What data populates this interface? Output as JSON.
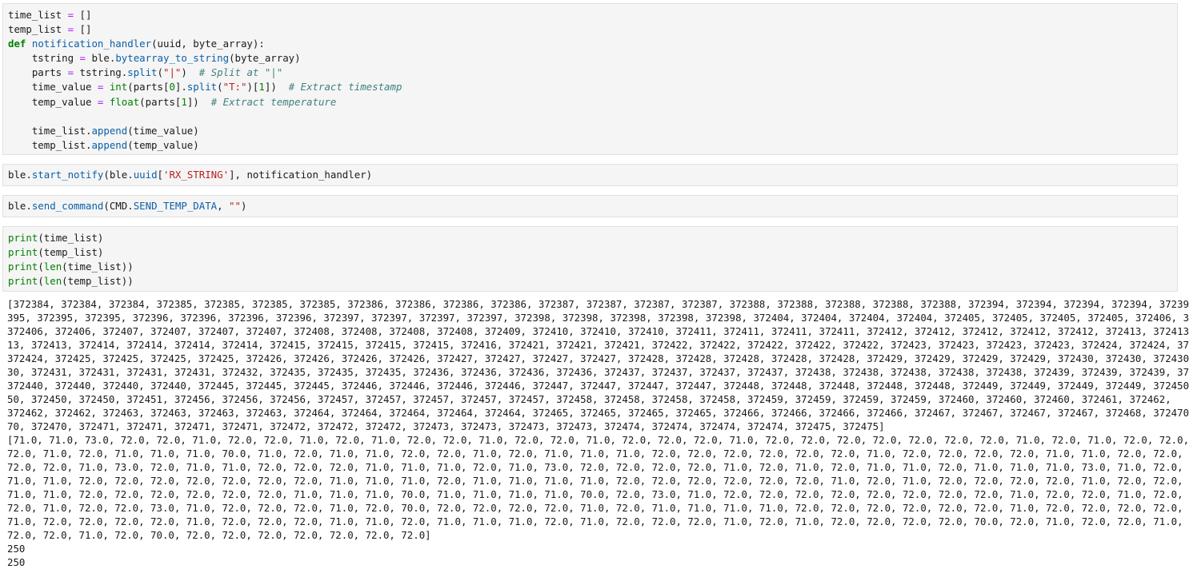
{
  "cells": [
    {
      "lines": [
        [
          {
            "t": "time_list ",
            "c": ""
          },
          {
            "t": "=",
            "c": "op"
          },
          {
            "t": " []",
            "c": ""
          }
        ],
        [
          {
            "t": "temp_list ",
            "c": ""
          },
          {
            "t": "=",
            "c": "op"
          },
          {
            "t": " []",
            "c": ""
          }
        ],
        [
          {
            "t": "def",
            "c": "kw"
          },
          {
            "t": " ",
            "c": ""
          },
          {
            "t": "notification_handler",
            "c": "fn"
          },
          {
            "t": "(uuid, byte_array):",
            "c": ""
          }
        ],
        [
          {
            "t": "    tstring ",
            "c": ""
          },
          {
            "t": "=",
            "c": "op"
          },
          {
            "t": " ble.",
            "c": ""
          },
          {
            "t": "bytearray_to_string",
            "c": "at"
          },
          {
            "t": "(byte_array)",
            "c": ""
          }
        ],
        [
          {
            "t": "    parts ",
            "c": ""
          },
          {
            "t": "=",
            "c": "op"
          },
          {
            "t": " tstring.",
            "c": ""
          },
          {
            "t": "split",
            "c": "at"
          },
          {
            "t": "(",
            "c": ""
          },
          {
            "t": "\"|\"",
            "c": "st"
          },
          {
            "t": ")  ",
            "c": ""
          },
          {
            "t": "# Split at \"|\"",
            "c": "cm"
          }
        ],
        [
          {
            "t": "    time_value ",
            "c": ""
          },
          {
            "t": "=",
            "c": "op"
          },
          {
            "t": " ",
            "c": ""
          },
          {
            "t": "int",
            "c": "bi"
          },
          {
            "t": "(parts[",
            "c": ""
          },
          {
            "t": "0",
            "c": "nm"
          },
          {
            "t": "].",
            "c": ""
          },
          {
            "t": "split",
            "c": "at"
          },
          {
            "t": "(",
            "c": ""
          },
          {
            "t": "\"T:\"",
            "c": "st"
          },
          {
            "t": ")[",
            "c": ""
          },
          {
            "t": "1",
            "c": "nm"
          },
          {
            "t": "])  ",
            "c": ""
          },
          {
            "t": "# Extract timestamp",
            "c": "cm"
          }
        ],
        [
          {
            "t": "    temp_value ",
            "c": ""
          },
          {
            "t": "=",
            "c": "op"
          },
          {
            "t": " ",
            "c": ""
          },
          {
            "t": "float",
            "c": "bi"
          },
          {
            "t": "(parts[",
            "c": ""
          },
          {
            "t": "1",
            "c": "nm"
          },
          {
            "t": "])  ",
            "c": ""
          },
          {
            "t": "# Extract temperature",
            "c": "cm"
          }
        ],
        [
          {
            "t": " ",
            "c": ""
          }
        ],
        [
          {
            "t": "    time_list.",
            "c": ""
          },
          {
            "t": "append",
            "c": "at"
          },
          {
            "t": "(time_value)",
            "c": ""
          }
        ],
        [
          {
            "t": "    temp_list.",
            "c": ""
          },
          {
            "t": "append",
            "c": "at"
          },
          {
            "t": "(temp_value)",
            "c": ""
          }
        ]
      ]
    },
    {
      "lines": [
        [
          {
            "t": "ble.",
            "c": ""
          },
          {
            "t": "start_notify",
            "c": "at"
          },
          {
            "t": "(ble.",
            "c": ""
          },
          {
            "t": "uuid",
            "c": "at"
          },
          {
            "t": "[",
            "c": ""
          },
          {
            "t": "'RX_STRING'",
            "c": "st"
          },
          {
            "t": "], notification_handler)",
            "c": ""
          }
        ]
      ]
    },
    {
      "lines": [
        [
          {
            "t": "ble.",
            "c": ""
          },
          {
            "t": "send_command",
            "c": "at"
          },
          {
            "t": "(CMD.",
            "c": ""
          },
          {
            "t": "SEND_TEMP_DATA",
            "c": "at"
          },
          {
            "t": ", ",
            "c": ""
          },
          {
            "t": "\"\"",
            "c": "st"
          },
          {
            "t": ")",
            "c": ""
          }
        ]
      ]
    },
    {
      "lines": [
        [
          {
            "t": "print",
            "c": "bi"
          },
          {
            "t": "(time_list)",
            "c": ""
          }
        ],
        [
          {
            "t": "print",
            "c": "bi"
          },
          {
            "t": "(temp_list)",
            "c": ""
          }
        ],
        [
          {
            "t": "print",
            "c": "bi"
          },
          {
            "t": "(",
            "c": ""
          },
          {
            "t": "len",
            "c": "bi"
          },
          {
            "t": "(time_list))",
            "c": ""
          }
        ],
        [
          {
            "t": "print",
            "c": "bi"
          },
          {
            "t": "(",
            "c": ""
          },
          {
            "t": "len",
            "c": "bi"
          },
          {
            "t": "(temp_list))",
            "c": ""
          }
        ]
      ]
    }
  ],
  "output": {
    "lines": [
      "[372384, 372384, 372384, 372385, 372385, 372385, 372385, 372386, 372386, 372386, 372386, 372387, 372387, 372387, 372387, 372388, 372388, 372388, 372388, 372388, 372394, 372394, 372394, 372394, 372395, 372",
      "395, 372395, 372395, 372396, 372396, 372396, 372396, 372397, 372397, 372397, 372397, 372398, 372398, 372398, 372398, 372398, 372404, 372404, 372404, 372404, 372405, 372405, 372405, 372405, 372406, 372406,",
      "372406, 372406, 372407, 372407, 372407, 372407, 372408, 372408, 372408, 372408, 372409, 372410, 372410, 372410, 372411, 372411, 372411, 372411, 372412, 372412, 372412, 372412, 372412, 372413, 372413, 3724",
      "13, 372413, 372414, 372414, 372414, 372414, 372415, 372415, 372415, 372415, 372416, 372421, 372421, 372421, 372422, 372422, 372422, 372422, 372422, 372423, 372423, 372423, 372423, 372424, 372424, 372424,",
      "372424, 372425, 372425, 372425, 372425, 372426, 372426, 372426, 372426, 372427, 372427, 372427, 372427, 372428, 372428, 372428, 372428, 372428, 372429, 372429, 372429, 372429, 372430, 372430, 372430, 3724",
      "30, 372431, 372431, 372431, 372431, 372432, 372435, 372435, 372435, 372436, 372436, 372436, 372436, 372437, 372437, 372437, 372437, 372438, 372438, 372438, 372438, 372438, 372439, 372439, 372439, 372439,",
      "372440, 372440, 372440, 372440, 372445, 372445, 372445, 372446, 372446, 372446, 372446, 372447, 372447, 372447, 372447, 372448, 372448, 372448, 372448, 372448, 372449, 372449, 372449, 372449, 372450, 3724",
      "50, 372450, 372450, 372451, 372456, 372456, 372456, 372457, 372457, 372457, 372457, 372457, 372458, 372458, 372458, 372458, 372459, 372459, 372459, 372459, 372460, 372460, 372460, 372461, 372462,",
      "372462, 372462, 372463, 372463, 372463, 372463, 372464, 372464, 372464, 372464, 372464, 372465, 372465, 372465, 372465, 372466, 372466, 372466, 372466, 372467, 372467, 372467, 372467, 372468, 372470, 3724",
      "70, 372470, 372471, 372471, 372471, 372471, 372472, 372472, 372472, 372473, 372473, 372473, 372473, 372474, 372474, 372474, 372474, 372475, 372475]",
      "[71.0, 71.0, 73.0, 72.0, 72.0, 71.0, 72.0, 72.0, 71.0, 72.0, 71.0, 72.0, 72.0, 71.0, 72.0, 72.0, 71.0, 72.0, 72.0, 72.0, 71.0, 72.0, 72.0, 72.0, 72.0, 72.0, 72.0, 72.0, 71.0, 72.0, 71.0, 72.0, 72.0, 72.0,",
      "72.0, 71.0, 72.0, 71.0, 71.0, 71.0, 70.0, 71.0, 72.0, 71.0, 71.0, 72.0, 72.0, 71.0, 72.0, 71.0, 71.0, 71.0, 72.0, 72.0, 72.0, 72.0, 72.0, 72.0, 71.0, 72.0, 72.0, 72.0, 72.0, 71.0, 71.0, 72.0, 72.0, 72.0,",
      "72.0, 72.0, 71.0, 73.0, 72.0, 71.0, 71.0, 72.0, 72.0, 72.0, 71.0, 71.0, 71.0, 72.0, 71.0, 73.0, 72.0, 72.0, 72.0, 72.0, 71.0, 72.0, 71.0, 72.0, 71.0, 71.0, 72.0, 71.0, 71.0, 71.0, 73.0, 71.0, 72.0, 70.0,",
      "71.0, 71.0, 72.0, 72.0, 72.0, 72.0, 72.0, 72.0, 72.0, 71.0, 71.0, 71.0, 72.0, 71.0, 71.0, 71.0, 71.0, 72.0, 72.0, 72.0, 72.0, 72.0, 72.0, 71.0, 72.0, 71.0, 72.0, 72.0, 72.0, 72.0, 71.0, 72.0, 72.0, 72.0,",
      "71.0, 71.0, 72.0, 72.0, 72.0, 72.0, 72.0, 72.0, 71.0, 71.0, 71.0, 70.0, 71.0, 71.0, 71.0, 71.0, 70.0, 72.0, 73.0, 71.0, 72.0, 72.0, 72.0, 72.0, 72.0, 72.0, 72.0, 72.0, 71.0, 72.0, 72.0, 71.0, 72.0, 72.0,",
      "72.0, 71.0, 72.0, 72.0, 73.0, 71.0, 72.0, 72.0, 72.0, 71.0, 72.0, 70.0, 72.0, 72.0, 72.0, 72.0, 71.0, 72.0, 71.0, 71.0, 71.0, 71.0, 72.0, 72.0, 72.0, 72.0, 72.0, 72.0, 71.0, 72.0, 72.0, 72.0, 72.0, 71.0,",
      "71.0, 72.0, 72.0, 72.0, 72.0, 71.0, 72.0, 72.0, 72.0, 71.0, 71.0, 72.0, 71.0, 71.0, 71.0, 72.0, 71.0, 72.0, 72.0, 72.0, 71.0, 72.0, 71.0, 72.0, 72.0, 72.0, 72.0, 70.0, 72.0, 71.0, 72.0, 72.0, 71.0, 71.0,",
      "72.0, 72.0, 71.0, 72.0, 70.0, 72.0, 72.0, 72.0, 72.0, 72.0, 72.0, 72.0]",
      "250",
      "250"
    ]
  }
}
